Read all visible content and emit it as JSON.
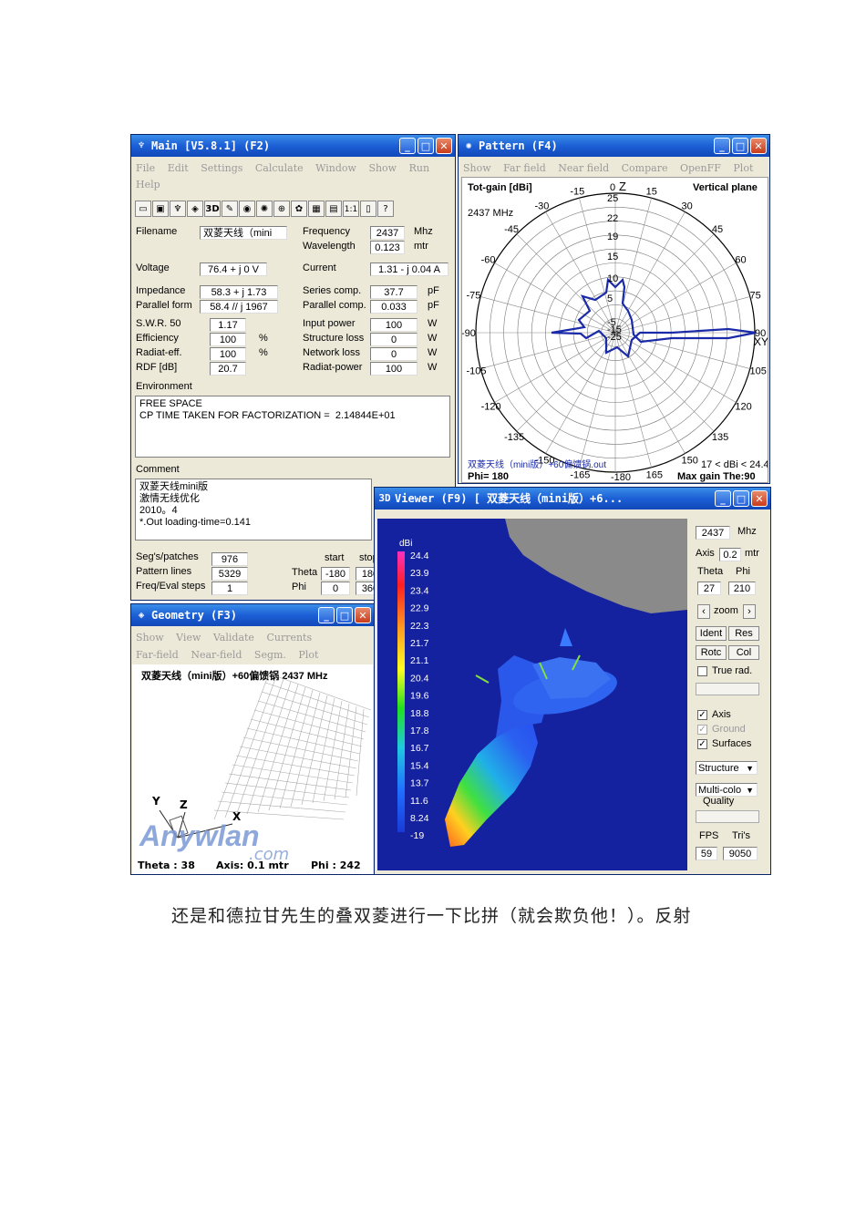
{
  "main": {
    "title": "Main [V5.8.1]    (F2)",
    "menu": [
      "File",
      "Edit",
      "Settings",
      "Calculate",
      "Window",
      "Show",
      "Run",
      "Help"
    ],
    "toolbar_3d": "3D",
    "toolbar_ratio": "1:1",
    "filename_label": "Filename",
    "filename_value": "双菱天线（mini",
    "frequency_label": "Frequency",
    "frequency_value": "2437",
    "frequency_unit": "Mhz",
    "wavelength_label": "Wavelength",
    "wavelength_value": "0.123",
    "wavelength_unit": "mtr",
    "voltage_label": "Voltage",
    "voltage_value": "76.4 + j 0 V",
    "current_label": "Current",
    "current_value": "1.31 - j 0.04 A",
    "impedance_label": "Impedance",
    "impedance_value": "58.3 + j 1.73",
    "parallel_form_label": "Parallel form",
    "parallel_form_value": "58.4 // j 1967",
    "series_comp_label": "Series comp.",
    "series_comp_value": "37.7",
    "parallel_comp_label": "Parallel comp.",
    "parallel_comp_value": "0.033",
    "pf": "pF",
    "swr_label": "S.W.R. 50",
    "swr_value": "1.17",
    "efficiency_label": "Efficiency",
    "efficiency_value": "100",
    "radiat_eff_label": "Radiat-eff.",
    "radiat_eff_value": "100",
    "rdf_label": "RDF [dB]",
    "rdf_value": "20.7",
    "percent": "%",
    "input_power_label": "Input power",
    "input_power_value": "100",
    "structure_loss_label": "Structure loss",
    "structure_loss_value": "0",
    "network_loss_label": "Network loss",
    "network_loss_value": "0",
    "radiat_power_label": "Radiat-power",
    "radiat_power_value": "100",
    "watt": "W",
    "environment_label": "Environment",
    "environment_text": "FREE SPACE\nCP TIME TAKEN FOR FACTORIZATION =  2.14844E+01",
    "comment_label": "Comment",
    "comment_text": "双菱天线mini版\n激情无线优化\n2010。4\n*.Out loading-time=0.141",
    "segs_label": "Seg's/patches",
    "segs_value": "976",
    "pattern_lines_label": "Pattern lines",
    "pattern_lines_value": "5329",
    "freq_eval_label": "Freq/Eval steps",
    "freq_eval_value": "1",
    "start_label": "start",
    "stop_label": "stop",
    "theta_label": "Theta",
    "theta_start": "-180",
    "theta_stop": "180",
    "phi_label": "Phi",
    "phi_start": "0",
    "phi_stop": "360"
  },
  "pattern": {
    "title": "Pattern     (F4)",
    "menu": [
      "Show",
      "Far field",
      "Near field",
      "Compare",
      "OpenFF",
      "Plot"
    ],
    "tot_gain": "Tot-gain [dBi]",
    "vertical_plane": "Vertical plane",
    "freq": "2437 MHz",
    "z_label": "Z",
    "xy_label": "XY",
    "angles_left": [
      "-15",
      "-30",
      "-45",
      "-60",
      "-75",
      "-90",
      "-105",
      "-120",
      "-135",
      "-150",
      "-165"
    ],
    "angles_right": [
      "15",
      "30",
      "45",
      "60",
      "75",
      "90",
      "105",
      "120",
      "135",
      "150",
      "165"
    ],
    "top_zero": "0",
    "bottom": "-180",
    "rings": [
      "25",
      "22",
      "19",
      "15",
      "10",
      "5",
      "-5",
      "-15",
      "-25"
    ],
    "footer_file": "双菱天线（mini版）+60偏馈锅.out",
    "footer_phi": "Phi= 180",
    "footer_range": "17 < dBi < 24.4",
    "footer_max": "Max gain The:90"
  },
  "viewer": {
    "title": "Viewer  (F9)        [  双菱天线（mini版）+6...",
    "legend_title": "dBi",
    "legend": [
      "24.4",
      "23.9",
      "23.4",
      "22.9",
      "22.3",
      "21.7",
      "21.1",
      "20.4",
      "19.6",
      "18.8",
      "17.8",
      "16.7",
      "15.4",
      "13.7",
      "11.6",
      "8.24",
      "-19"
    ],
    "freq_value": "2437",
    "freq_unit": "Mhz",
    "axis_label": "Axis",
    "axis_value": "0.2",
    "axis_unit": "mtr",
    "theta_label": "Theta",
    "phi_label": "Phi",
    "theta_value": "27",
    "phi_value": "210",
    "zoom_label": "zoom",
    "ident": "Ident",
    "res": "Res",
    "rotc": "Rotc",
    "col": "Col",
    "true_rad": "True rad.",
    "axis_chk": "Axis",
    "ground_chk": "Ground",
    "surfaces_chk": "Surfaces",
    "structure_sel": "Structure",
    "multicolor_sel": "Multi-colo",
    "quality": "Quality",
    "fps_label": "FPS",
    "tris_label": "Tri's",
    "fps_value": "59",
    "tris_value": "9050"
  },
  "geometry": {
    "title": "Geometry    (F3)",
    "menu1": [
      "Show",
      "View",
      "Validate",
      "Currents"
    ],
    "menu2": [
      "Far-field",
      "Near-field",
      "Segm.",
      "Plot"
    ],
    "heading": "双菱天线（mini版）+60偏馈锅 2437 MHz",
    "axis_y": "Y",
    "axis_z": "Z",
    "axis_x": "X",
    "watermark": "Anywlan",
    "watermark_sub": ".com",
    "theta": "Theta : 38",
    "axis": "Axis: 0.1 mtr",
    "phi": "Phi : 242"
  },
  "caption": "还是和德拉甘先生的叠双菱进行一下比拼（就会欺负他！）。反射"
}
